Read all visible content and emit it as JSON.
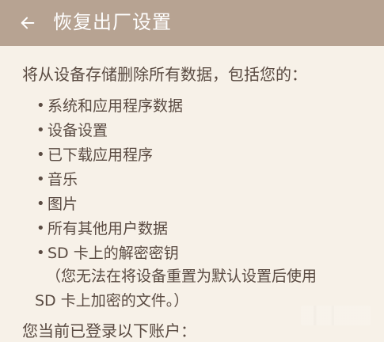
{
  "header": {
    "title": "恢复出厂设置",
    "back_icon": "arrow-left-icon"
  },
  "content": {
    "intro": "将从设备存储删除所有数据，包括您的：",
    "items": [
      "系统和应用程序数据",
      "设备设置",
      "已下载应用程序",
      "音乐",
      "图片",
      "所有其他用户数据",
      "SD 卡上的解密密钥"
    ],
    "note_line1": "（您无法在将设备重置为默认设置后使用",
    "note_line2": "SD 卡上加密的文件。）",
    "account_label": "您当前已登录以下账户："
  },
  "colors": {
    "header_background": "#b7a392",
    "page_background": "#f7f1e8",
    "text": "#5a4b42",
    "header_text": "#ffffff"
  }
}
